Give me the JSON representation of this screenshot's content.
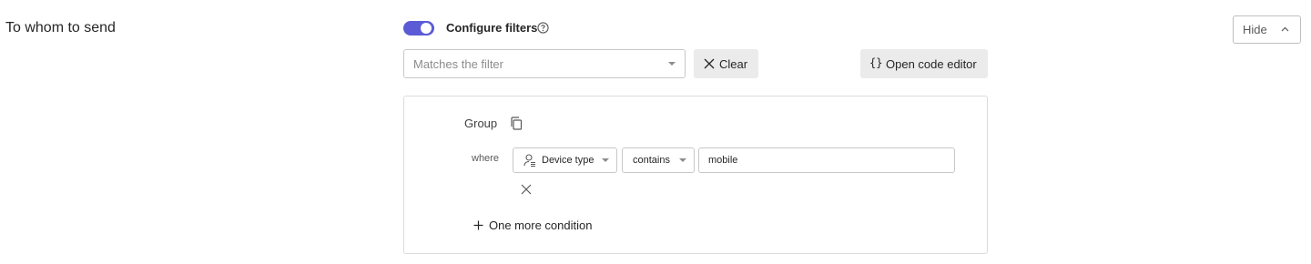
{
  "section": {
    "title": "To whom to send"
  },
  "filters": {
    "toggle_on": true,
    "label": "Configure filters",
    "hide_label": "Hide",
    "match_placeholder": "Matches the filter",
    "clear_label": "Clear",
    "code_editor_label": "Open code editor",
    "code_editor_icon_glyph": "{}"
  },
  "group": {
    "label": "Group",
    "condition": {
      "where_label": "where",
      "field": "Device type",
      "operator": "contains",
      "value": "mobile"
    },
    "add_condition_label": "One more condition"
  },
  "colors": {
    "accent": "#5b5bd6",
    "button_bg": "#ebebeb",
    "border": "#c8c8c8"
  },
  "icons": [
    "help-icon",
    "chevron-up-icon",
    "close-icon",
    "code-braces-icon",
    "copy-icon",
    "user-device-icon",
    "remove-icon",
    "plus-icon"
  ]
}
